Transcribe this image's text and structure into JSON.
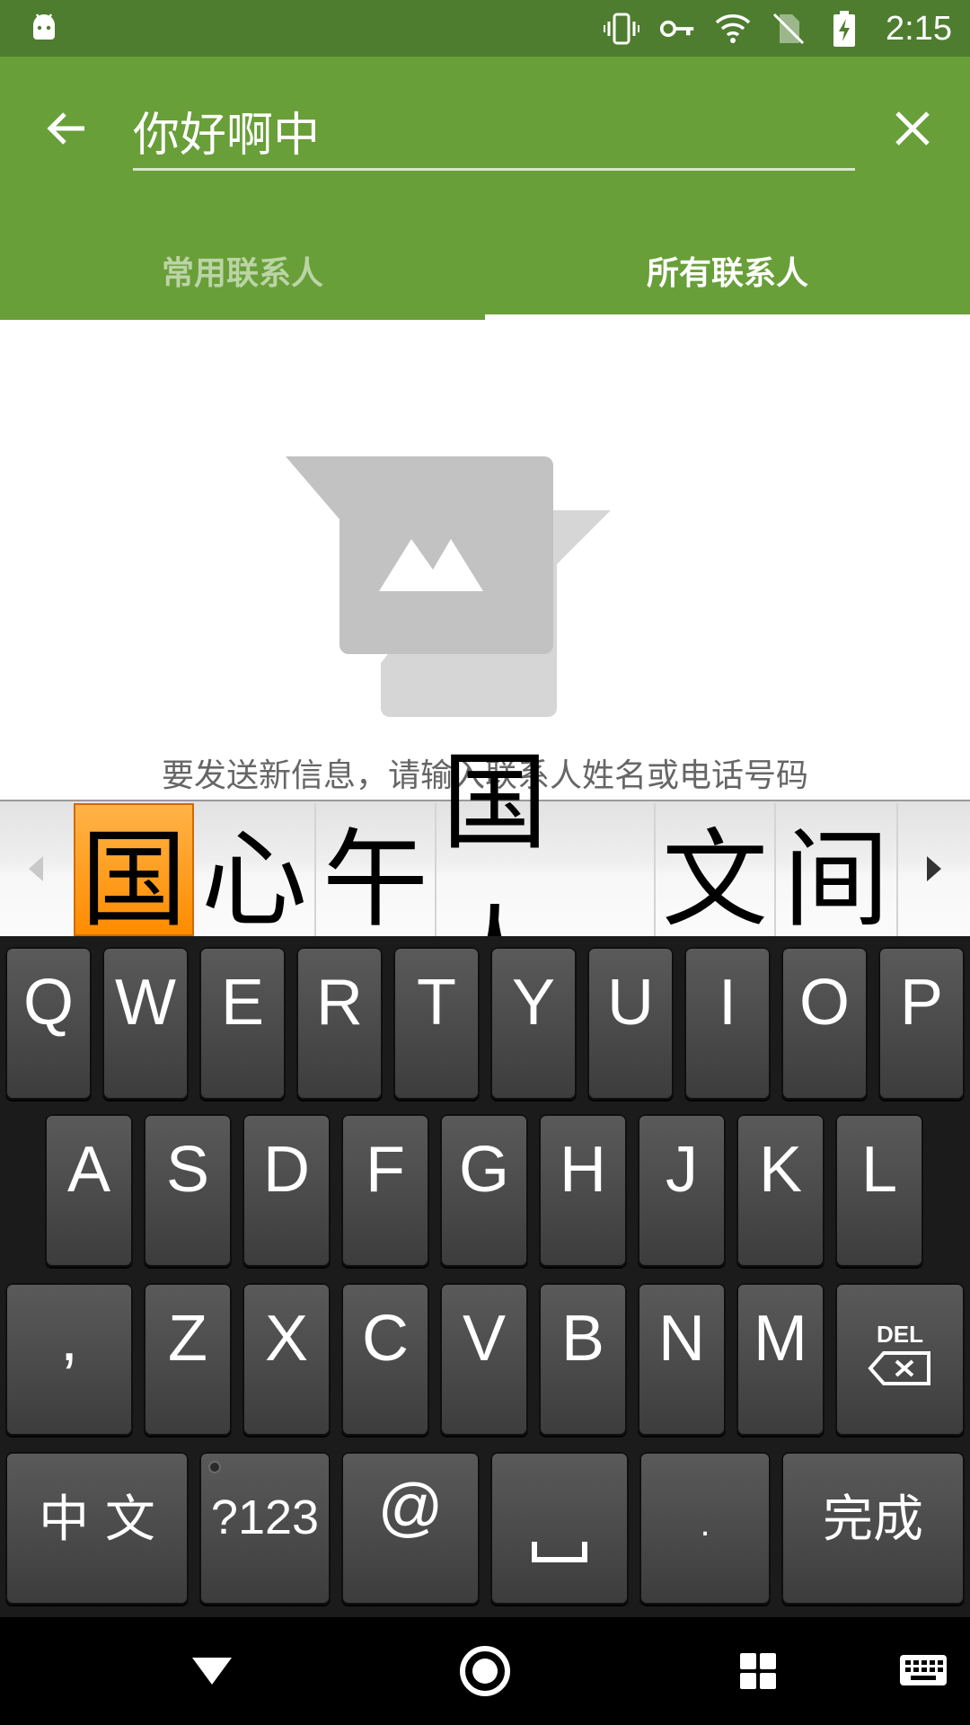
{
  "status_bar": {
    "time": "2:15",
    "icons": [
      "android-icon",
      "vibrate-icon",
      "vpn-key-icon",
      "wifi-icon",
      "no-sim-icon",
      "battery-charging-icon"
    ]
  },
  "search": {
    "value": "你好啊中"
  },
  "tabs": [
    {
      "label": "常用联系人",
      "active": false
    },
    {
      "label": "所有联系人",
      "active": true
    }
  ],
  "empty_state": {
    "message": "要发送新信息，请输入联系人姓名或电话号码"
  },
  "candidates": {
    "items": [
      "国",
      "心",
      "午",
      "国人",
      "文",
      "间"
    ],
    "selected_index": 0,
    "highlight_color": "#ff9a1a"
  },
  "keyboard": {
    "row1": [
      "Q",
      "W",
      "E",
      "R",
      "T",
      "Y",
      "U",
      "I",
      "O",
      "P"
    ],
    "row2": [
      "A",
      "S",
      "D",
      "F",
      "G",
      "H",
      "J",
      "K",
      "L"
    ],
    "row3": [
      ",",
      "Z",
      "X",
      "C",
      "V",
      "B",
      "N",
      "M"
    ],
    "del_label": "DEL",
    "row4": {
      "lang": "中 文",
      "symbols": "?123",
      "at": "@",
      "space": "␣",
      "period": ".",
      "done": "完成"
    }
  },
  "colors": {
    "status_bar": "#4e7d2f",
    "app_bar": "#689f38"
  },
  "nav_bar": {
    "icons": [
      "back-triangle-icon",
      "home-circle-icon",
      "recents-grid-icon",
      "keyboard-icon"
    ]
  }
}
